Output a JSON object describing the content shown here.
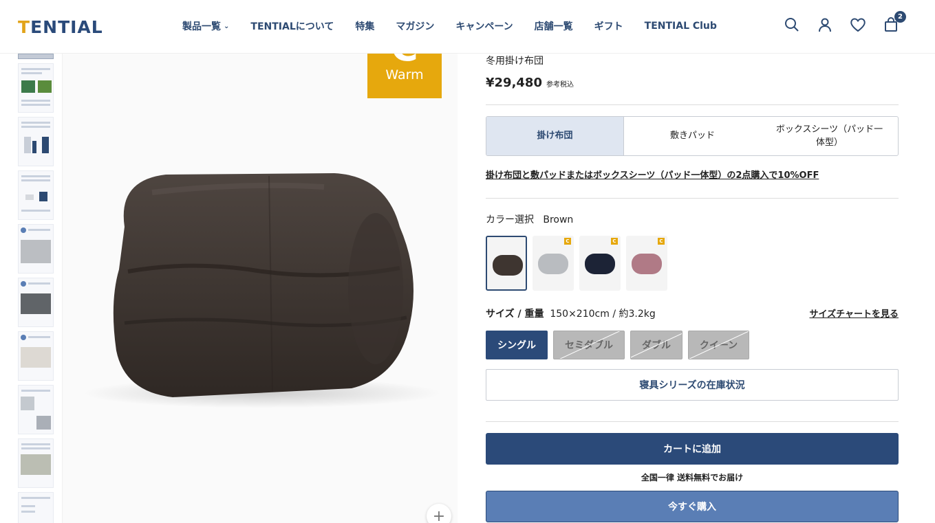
{
  "header": {
    "logo": "TENTIAL",
    "nav": [
      {
        "label": "製品一覧",
        "has_dropdown": true
      },
      {
        "label": "TENTIALについて"
      },
      {
        "label": "特集"
      },
      {
        "label": "マガジン"
      },
      {
        "label": "キャンペーン"
      },
      {
        "label": "店舗一覧"
      },
      {
        "label": "ギフト"
      },
      {
        "label": "TENTIAL Club"
      }
    ],
    "cart_count": "2",
    "icons": [
      "search-icon",
      "account-icon",
      "favorite-heart-icon",
      "cart-bag-icon"
    ]
  },
  "gallery": {
    "badge_letter": "C",
    "badge_word": "Warm",
    "zoom_symbol": "+"
  },
  "product": {
    "subtitle": "冬用掛け布団",
    "price": "¥29,480",
    "tax_note": "参考税込",
    "type_tabs": [
      {
        "label": "掛け布団",
        "active": true
      },
      {
        "label": "敷きパッド",
        "active": false
      },
      {
        "label": "ボックスシーツ（パッド一体型）",
        "active": false
      }
    ],
    "promo_link": "掛け布団と敷パッドまたはボックスシーツ（パッド一体型）の2点購入で10%OFF",
    "color_label": "カラー選択",
    "color_value": "Brown",
    "swatches": [
      {
        "color": "#3e3530",
        "selected": true
      },
      {
        "color": "#b9bcc0",
        "selected": false
      },
      {
        "color": "#1c2336",
        "selected": false
      },
      {
        "color": "#b07a86",
        "selected": false
      }
    ],
    "size_label": "サイズ / 重量",
    "size_value": "150×210cm / 約3.2kg",
    "size_chart_link": "サイズチャートを見る",
    "sizes": [
      {
        "label": "シングル",
        "available": true
      },
      {
        "label": "セミダブル",
        "available": false
      },
      {
        "label": "ダブル",
        "available": false
      },
      {
        "label": "クイーン",
        "available": false
      }
    ],
    "stock_button": "寝具シリーズの在庫状況",
    "add_to_cart": "カートに追加",
    "shipping_note": "全国一律 送料無料でお届け",
    "buy_now": "今すぐ購入"
  },
  "colors": {
    "navy": "#2b4a79",
    "accent_gold": "#e6a80d",
    "buy_now_blue": "#5a7eb5"
  }
}
